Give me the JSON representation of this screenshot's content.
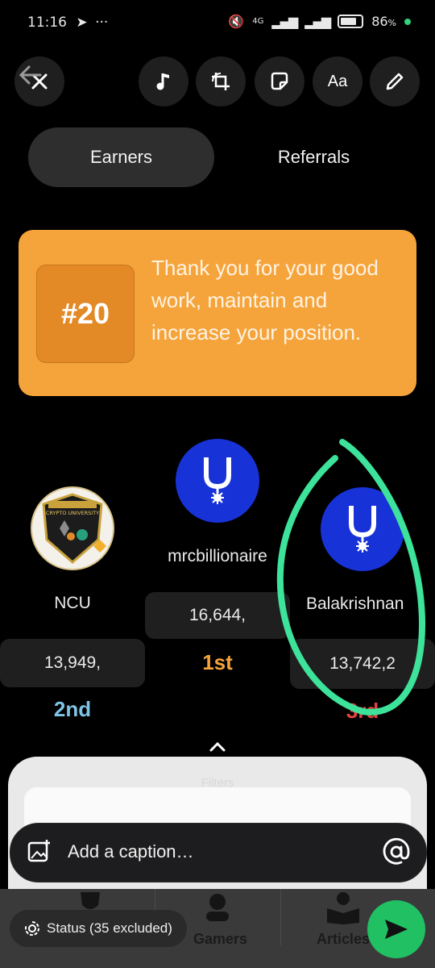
{
  "status_bar": {
    "time": "11:16",
    "network": "4G",
    "battery": "86",
    "battery_unit": "%"
  },
  "toolbar": {
    "close_icon": "close-icon",
    "music_icon": "music-icon",
    "crop_icon": "crop-rotate-icon",
    "sticker_icon": "sticker-icon",
    "text_label": "Aa",
    "draw_icon": "pencil-icon"
  },
  "tabs": [
    {
      "label": "Earners",
      "active": true
    },
    {
      "label": "Referrals",
      "active": false
    }
  ],
  "banner": {
    "rank": "#20",
    "message": "Thank you for your good work, maintain and increase your position.",
    "color": "#f5a43b"
  },
  "leaderboard": {
    "first": {
      "name": "mrcbillionaire",
      "score": "16,644,",
      "place": "1st",
      "color": "#f5a43b"
    },
    "second": {
      "name": "NCU",
      "score": "13,949,",
      "place": "2nd",
      "color": "#7fc4e6",
      "logo_text": "CRYPTO UNIVERSITY"
    },
    "third": {
      "name": "Balakrishnan",
      "score": "13,742,2",
      "place": "3rd",
      "color": "#e0443c"
    }
  },
  "filters": {
    "label": "Filters"
  },
  "caption": {
    "placeholder": "Add a caption…"
  },
  "bottom_nav": {
    "items": [
      "Gamers",
      "Articles"
    ],
    "status_chip": "Status (35 excluded)"
  },
  "annotation_color": "#3de39a",
  "accent_send": "#21c063"
}
